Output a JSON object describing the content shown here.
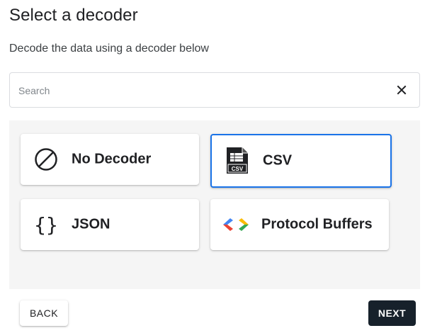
{
  "header": {
    "title": "Select a decoder",
    "subtitle": "Decode the data using a decoder below"
  },
  "search": {
    "placeholder": "Search",
    "value": "",
    "clear_icon": "close-icon"
  },
  "decoders": [
    {
      "label": "No Decoder",
      "icon": "no-decoder-icon",
      "selected": false
    },
    {
      "label": "CSV",
      "icon": "csv-file-icon",
      "selected": true
    },
    {
      "label": "JSON",
      "icon": "curly-braces-icon",
      "selected": false
    },
    {
      "label": "Protocol Buffers",
      "icon": "protocol-buffers-icon",
      "selected": false
    }
  ],
  "footer": {
    "back_label": "BACK",
    "next_label": "NEXT"
  },
  "colors": {
    "selected_border": "#1a73e8",
    "next_button_bg": "#17212b",
    "panel_bg": "#f5f5f5",
    "protobuf_blue": "#4285f4",
    "protobuf_red": "#ea4335",
    "protobuf_yellow": "#fbbc04",
    "protobuf_green": "#34a853"
  }
}
